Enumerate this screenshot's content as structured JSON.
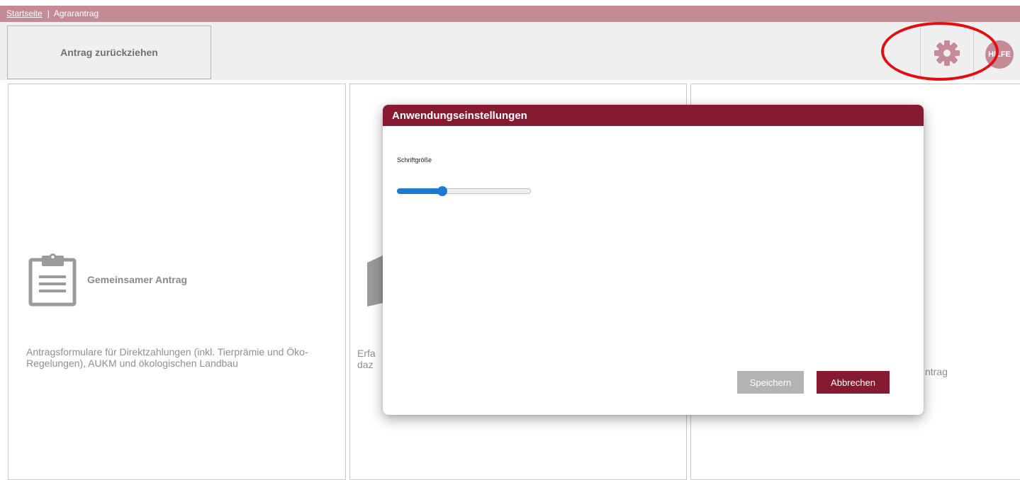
{
  "breadcrumb": {
    "home": "Startseite",
    "separator": "|",
    "current": "Agrarantrag"
  },
  "toolbar": {
    "withdraw_label": "Antrag zurückziehen",
    "settings_icon": "gear-icon",
    "help_label": "HILFE"
  },
  "tiles": [
    {
      "icon": "clipboard-icon",
      "title": "Gemeinsamer Antrag",
      "description": "Antragsformulare für Direktzahlungen (inkl. Tierprämie und Öko-Regelungen), AUKM und ökologischen Landbau"
    },
    {
      "icon": "map-icon",
      "description_line1": "Erfa",
      "description_line2": "daz"
    },
    {
      "description_fragment": "ntrag"
    }
  ],
  "modal": {
    "title": "Anwendungseinstellungen",
    "font_size_label": "Schriftgröße",
    "font_size_slider_value": 0.34,
    "save_label": "Speichern",
    "cancel_label": "Abbrechen"
  },
  "colors": {
    "brand": "#851a30",
    "breadcrumb_bg": "#c48a96",
    "slider_accent": "#1f78d1",
    "annotation": "#e01010"
  }
}
